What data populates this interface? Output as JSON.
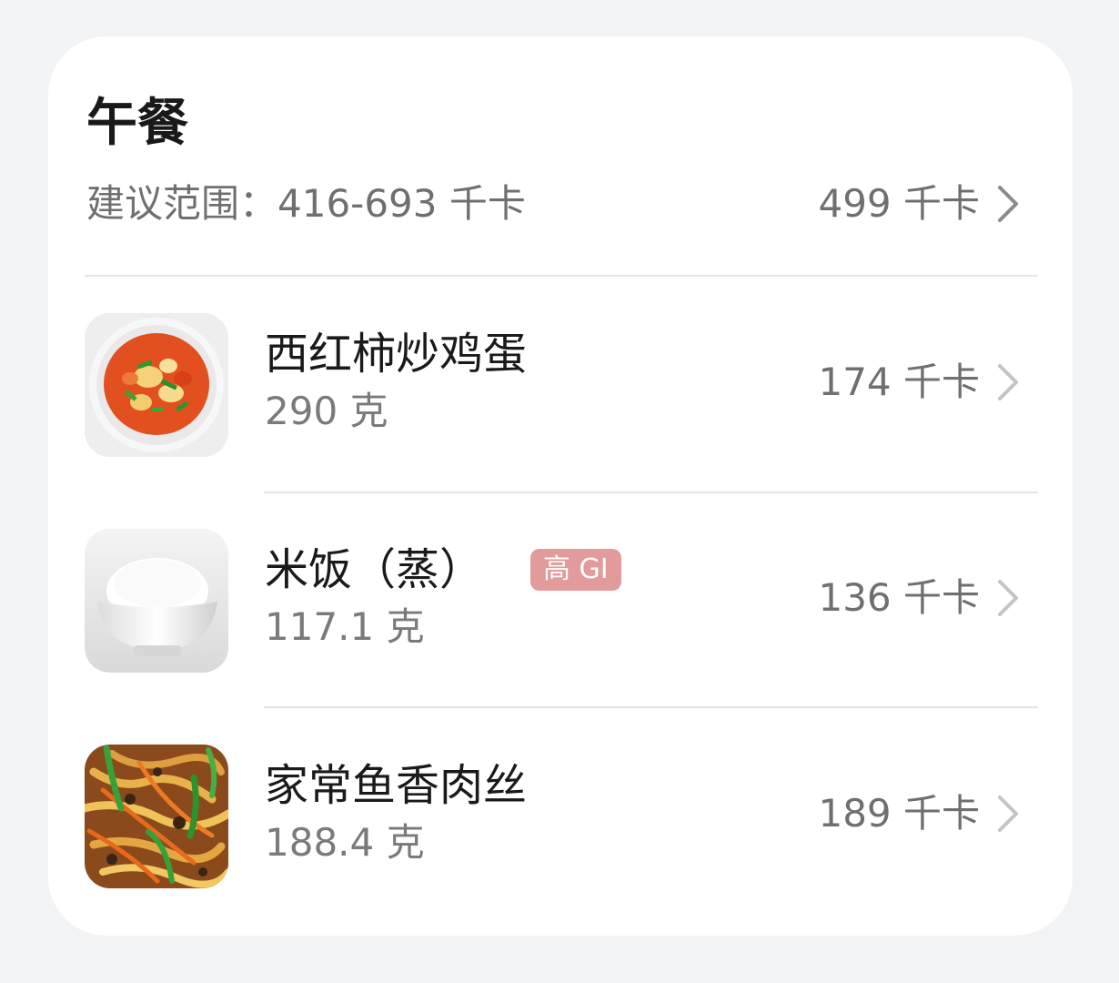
{
  "meal": {
    "title": "午餐",
    "range_text": "建议范围：416-693 千卡",
    "total_kcal": "499 千卡"
  },
  "foods": [
    {
      "name": "西红柿炒鸡蛋",
      "weight": "290 克",
      "kcal": "174 千卡",
      "icon": "tomato-egg-dish-icon"
    },
    {
      "name": "米饭（蒸）",
      "weight": "117.1 克",
      "kcal": "136 千卡",
      "badge": "高 GI",
      "icon": "steamed-rice-bowl-icon"
    },
    {
      "name": "家常鱼香肉丝",
      "weight": "188.4 克",
      "kcal": "189 千卡",
      "icon": "shredded-pork-dish-icon"
    }
  ],
  "colors": {
    "background": "#f1f3f5",
    "card": "#ffffff",
    "badge": "#e29a9a",
    "secondary_text": "#6f6f6f"
  }
}
